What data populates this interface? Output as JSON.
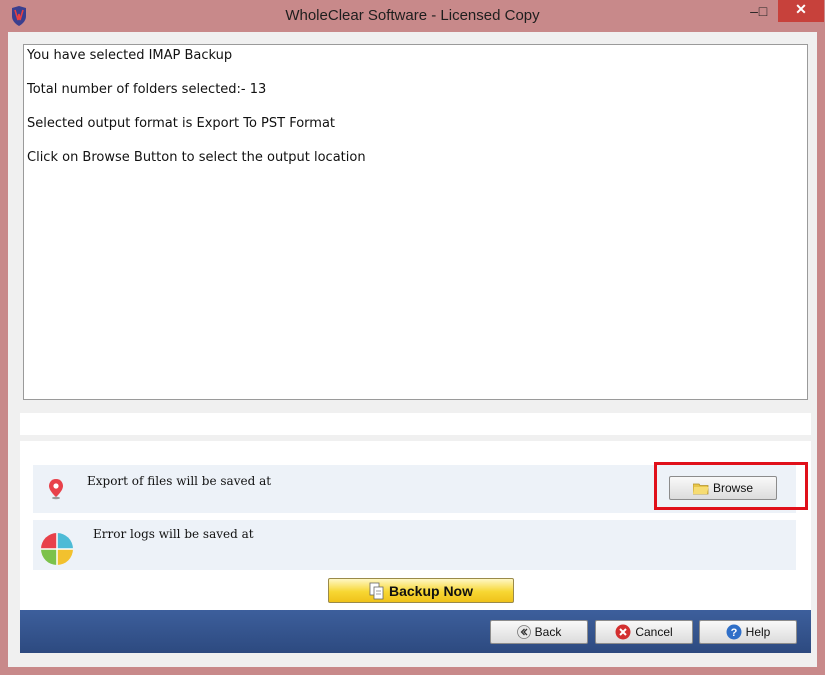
{
  "window": {
    "title": "WholeClear Software - Licensed Copy",
    "minimize_label": "–",
    "maximize_label": "□",
    "close_label": "✕"
  },
  "log": {
    "lines": [
      "You have selected IMAP Backup",
      "Total number of folders selected:- 13",
      "Selected output format is Export To PST Format",
      "Click on Browse Button to select the output location"
    ]
  },
  "export_row": {
    "label": "Export of files will be saved at",
    "icon": "location-pin-icon",
    "browse_label": "Browse"
  },
  "error_row": {
    "label": "Error logs will be saved at",
    "icon": "pie-chart-icon"
  },
  "actions": {
    "backup_label": "Backup Now"
  },
  "footer": {
    "back_label": "Back",
    "cancel_label": "Cancel",
    "help_label": "Help"
  },
  "colors": {
    "window_border": "#c8898a",
    "highlight": "#e0101a",
    "footer": "#3d5f9c",
    "backup_button": "#f7d733"
  }
}
